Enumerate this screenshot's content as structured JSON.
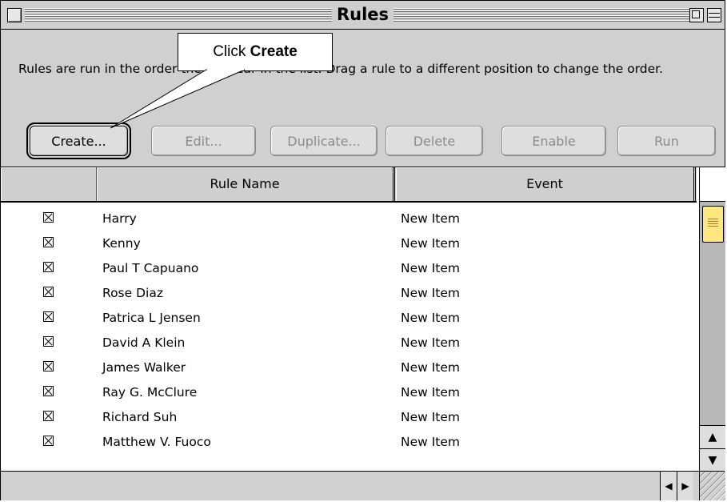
{
  "window": {
    "title": "Rules"
  },
  "description": "Rules are run in the order they appear in the list. Drag a rule to a different position to change the order.",
  "buttons": {
    "create": "Create...",
    "edit": "Edit...",
    "duplicate": "Duplicate...",
    "delete": "Delete",
    "enable": "Enable",
    "run": "Run"
  },
  "table": {
    "headers": {
      "enabled": "",
      "name": "Rule Name",
      "event": "Event"
    },
    "rows": [
      {
        "checked": true,
        "name": "Harry",
        "event": "New Item"
      },
      {
        "checked": true,
        "name": "Kenny",
        "event": "New Item"
      },
      {
        "checked": true,
        "name": "Paul T Capuano",
        "event": "New Item"
      },
      {
        "checked": true,
        "name": "Rose Diaz",
        "event": "New Item"
      },
      {
        "checked": true,
        "name": "Patrica L Jensen",
        "event": "New Item"
      },
      {
        "checked": true,
        "name": "David A Klein",
        "event": "New Item"
      },
      {
        "checked": true,
        "name": "James Walker",
        "event": "New Item"
      },
      {
        "checked": true,
        "name": "Ray G. McClure",
        "event": "New Item"
      },
      {
        "checked": true,
        "name": "Richard Suh",
        "event": "New Item"
      },
      {
        "checked": true,
        "name": "Matthew V. Fuoco",
        "event": "New Item"
      }
    ]
  },
  "callout": {
    "prefix": "Click ",
    "bold": "Create"
  },
  "icons": {
    "close": "close-box-icon",
    "zoom": "zoom-box-icon",
    "collapse": "collapse-box-icon",
    "checkbox": "checkbox-checked-icon",
    "scroll_up": "arrow-up-icon",
    "scroll_down": "arrow-down-icon",
    "scroll_left": "arrow-left-icon",
    "scroll_right": "arrow-right-icon",
    "grow": "grow-box-icon"
  },
  "colors": {
    "window_bg": "#d0d0d0",
    "scroll_thumb": "#ffe680",
    "disabled_text": "#8c8c8c"
  }
}
